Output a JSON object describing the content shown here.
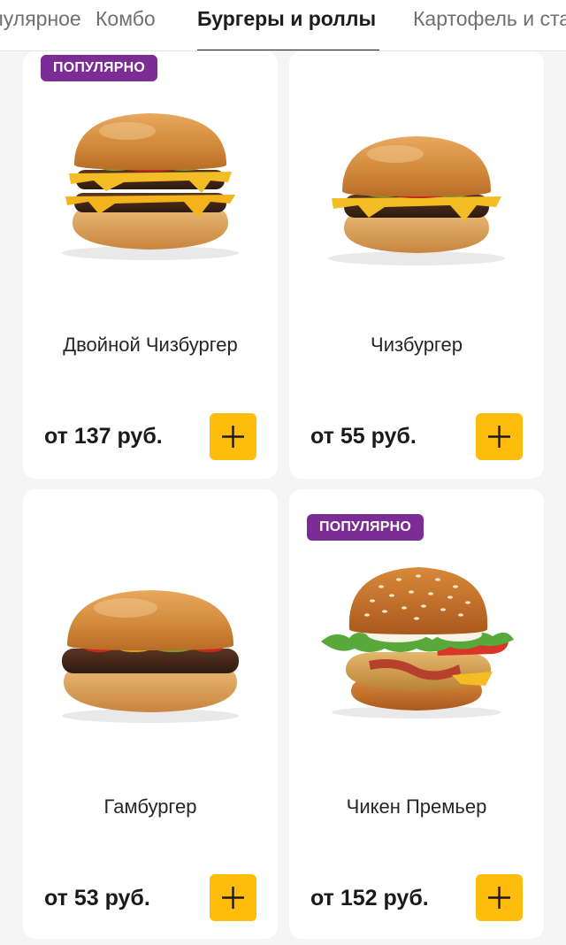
{
  "tabs": [
    {
      "label": "Популярное",
      "active": false
    },
    {
      "label": "Комбо",
      "active": false
    },
    {
      "label": "Бургеры и роллы",
      "active": true
    },
    {
      "label": "Картофель и стартеры",
      "active": false
    }
  ],
  "products": [
    {
      "name": "Двойной Чизбургер",
      "price": "от 137 руб.",
      "badge": "ПОПУЛЯРНО",
      "image": "double-cheeseburger"
    },
    {
      "name": "Чизбургер",
      "price": "от 55 руб.",
      "badge": "",
      "image": "cheeseburger"
    },
    {
      "name": "Гамбургер",
      "price": "от 53 руб.",
      "badge": "",
      "image": "hamburger"
    },
    {
      "name": "Чикен Премьер",
      "price": "от 152 руб.",
      "badge": "ПОПУЛЯРНО",
      "image": "chicken-premier"
    }
  ],
  "icons": {
    "add": "plus-icon"
  },
  "colors": {
    "accent": "#ffbc0d",
    "badge": "#7c2c95",
    "background": "#f5f5f5",
    "card": "#ffffff"
  }
}
